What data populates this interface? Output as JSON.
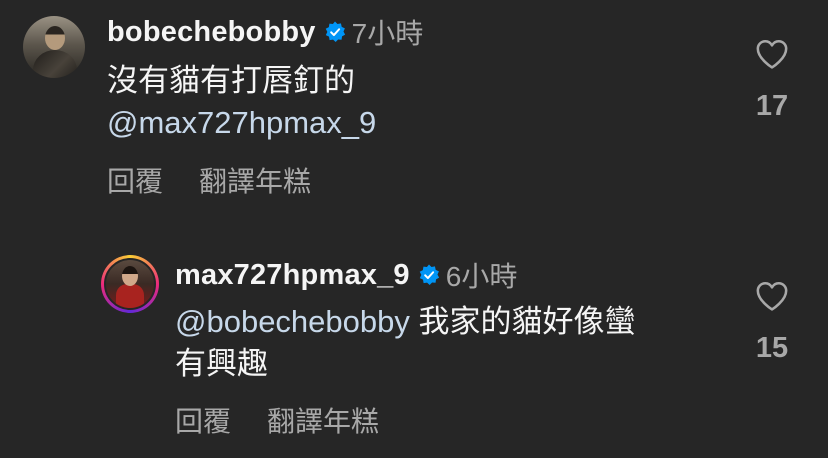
{
  "comments": [
    {
      "username": "bobechebobby",
      "verified": true,
      "timestamp": "7小時",
      "text_line1": "沒有貓有打唇釘的",
      "text_line2_mention": "@max727hpmax_9",
      "actions": {
        "reply": "回覆",
        "translate": "翻譯年糕"
      },
      "likes": "17",
      "icons": {
        "verified": "verified-badge-icon",
        "like": "heart-icon"
      }
    },
    {
      "username": "max727hpmax_9",
      "verified": true,
      "timestamp": "6小時",
      "mention": "@bobechebobby",
      "text_line1_rest": " 我家的貓好像蠻",
      "text_line2": "有興趣",
      "actions": {
        "reply": "回覆",
        "translate": "翻譯年糕"
      },
      "likes": "15",
      "icons": {
        "verified": "verified-badge-icon",
        "like": "heart-icon"
      }
    }
  ],
  "colors": {
    "background": "#262626",
    "primary_text": "#f5f5f5",
    "secondary_text": "#a8a8a8",
    "verified_blue": "#0095f6",
    "mention": "#c7d8ea"
  }
}
